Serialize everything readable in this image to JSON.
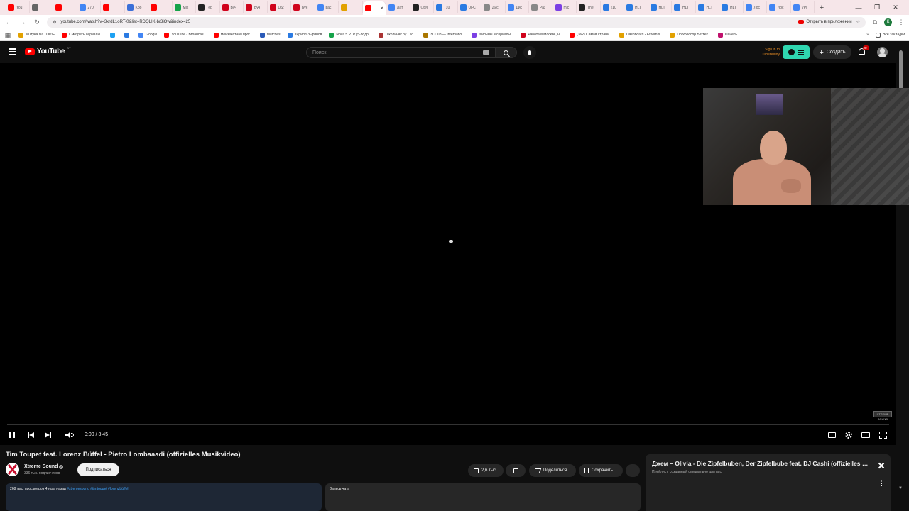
{
  "browser": {
    "tabs": [
      {
        "label": "You",
        "color": "#ff0000"
      },
      {
        "label": "",
        "color": "#666666"
      },
      {
        "label": "",
        "color": "#ff0000"
      },
      {
        "label": "270",
        "color": "#4285f4"
      },
      {
        "label": "",
        "color": "#ff0000"
      },
      {
        "label": "Kpo",
        "color": "#3b6fd8"
      },
      {
        "label": "",
        "color": "#ff0000"
      },
      {
        "label": "Mix",
        "color": "#15a34a"
      },
      {
        "label": "Гер",
        "color": "#222222"
      },
      {
        "label": "Буч",
        "color": "#d0021b"
      },
      {
        "label": "Буч",
        "color": "#d0021b"
      },
      {
        "label": "US:",
        "color": "#d0021b"
      },
      {
        "label": "Бун",
        "color": "#d0021b"
      },
      {
        "label": "вас",
        "color": "#4285f4"
      },
      {
        "label": "",
        "color": "#e2a100"
      },
      {
        "label": "",
        "color": "#ff0000"
      },
      {
        "label": "Лат",
        "color": "#4285f4"
      },
      {
        "label": "Оря",
        "color": "#222222"
      },
      {
        "label": "(10",
        "color": "#2a7ae2"
      },
      {
        "label": "UFC",
        "color": "#2a7ae2"
      },
      {
        "label": "Дис",
        "color": "#888888"
      },
      {
        "label": "Дис",
        "color": "#4285f4"
      },
      {
        "label": "Раз",
        "color": "#888888"
      },
      {
        "label": "mic",
        "color": "#7b3fe4"
      },
      {
        "label": "The",
        "color": "#222222"
      },
      {
        "label": "(10",
        "color": "#2a7ae2"
      },
      {
        "label": "HLT",
        "color": "#2a7ae2"
      },
      {
        "label": "HLT",
        "color": "#2a7ae2"
      },
      {
        "label": "HLT",
        "color": "#2a7ae2"
      },
      {
        "label": "HLT",
        "color": "#2a7ae2"
      },
      {
        "label": "HLT",
        "color": "#2a7ae2"
      },
      {
        "label": "Лос",
        "color": "#4285f4"
      },
      {
        "label": "Лос",
        "color": "#4285f4"
      },
      {
        "label": "VPI",
        "color": "#4285f4"
      }
    ],
    "active_tab_index": 15,
    "url": "youtube.com/watch?v=3xrdL1oRT-0&list=RDQLIK-br3iOw&index=25",
    "open_in_app": "Открыть в приложении",
    "profile_letter": "K",
    "bookmarks": [
      {
        "label": "Muzyka Na TOPIE",
        "color": "#e2a100"
      },
      {
        "label": "Смотреть сериалы...",
        "color": "#ff0000"
      },
      {
        "label": "",
        "color": "#1da1f2"
      },
      {
        "label": "",
        "color": "#2a7ae2"
      },
      {
        "label": "Google",
        "color": "#4285f4"
      },
      {
        "label": "YouTube - Broadcas...",
        "color": "#ff0000"
      },
      {
        "label": "Неизвестная прог...",
        "color": "#ff0000"
      },
      {
        "label": "Matches",
        "color": "#2a5ab8"
      },
      {
        "label": "Кирилл Зырянов",
        "color": "#2a7ae2"
      },
      {
        "label": "Nova 5 PTP (5-подр...",
        "color": "#15a34a"
      },
      {
        "label": "Школьник.ру | Ус...",
        "color": "#aa3333"
      },
      {
        "label": "3CCup — Internatio...",
        "color": "#aa7700"
      },
      {
        "label": "Фильмы и сериалы...",
        "color": "#7b3fe4"
      },
      {
        "label": "Работа в Москве, н...",
        "color": "#d0021b"
      },
      {
        "label": "(362) Самая страни...",
        "color": "#ff0000"
      },
      {
        "label": "Dashboard - Ethernis...",
        "color": "#e2a100"
      },
      {
        "label": "Профессор Беттек...",
        "color": "#e2a100"
      },
      {
        "label": "Панель",
        "color": "#c0116d"
      }
    ],
    "all_bookmarks": "Все закладки"
  },
  "youtube": {
    "logo_text": "YouTube",
    "region": "BY",
    "search_placeholder": "Поиск",
    "tubebuddy_line1": "Sign in to",
    "tubebuddy_line2": "TubeBuddy",
    "create_label": "Создать",
    "notif_badge": "9+"
  },
  "player": {
    "time": "0:00 / 3:45",
    "progress_fraction": 0,
    "watermark": "XTREME SOUND"
  },
  "video": {
    "title": "Tim Toupet feat. Lorenz Büffel - Pietro Lombaaadi (offizielles Musikvideo)",
    "channel": "Xtreme Sound",
    "subscribers": "336 тыс. подписчиков",
    "subscribe_label": "Подписаться",
    "likes": "2,6 тыс.",
    "share_label": "Поделиться",
    "save_label": "Сохранить",
    "more_label": "···",
    "description_stats": "268 тыс. просмотров  4 года назад",
    "description_tags": "#xtremesound #timtoupet #lorenzbüffel",
    "clip_label": "Запись чата"
  },
  "playlist": {
    "title": "Джем – Olivia - Die Zipfelbuben, Der Zipfelbube feat. DJ Cashi (offizielles Musikvideo)",
    "subtitle": "Плейлист, созданный специально для вас",
    "menu_label": "⋮"
  }
}
